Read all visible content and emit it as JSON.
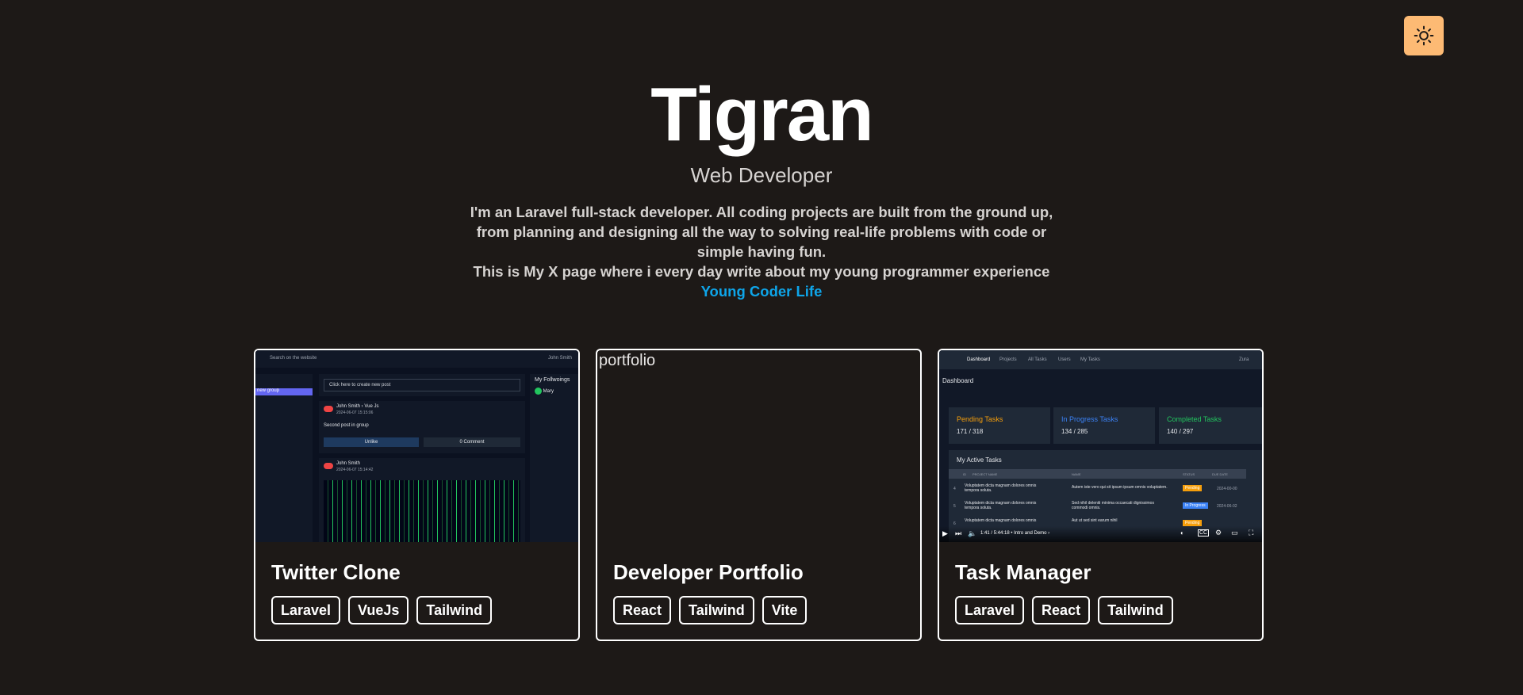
{
  "colors": {
    "background": "#1d1917",
    "accent": "#fdba74",
    "link": "#0ea5e9"
  },
  "theme_toggle": {
    "icon": "sun-icon"
  },
  "hero": {
    "name": "Tigran",
    "subtitle": "Web Developer",
    "bio_line1": "I'm an Laravel full-stack developer. All coding projects are built from the ground up, from planning and designing all the way to solving real-life problems with code or simple having fun.",
    "bio_line2": "This is My X page where i every day write about my young programmer experience",
    "x_link": "Young Coder Life"
  },
  "projects": [
    {
      "title": "Twitter Clone",
      "tags": [
        "Laravel",
        "VueJs",
        "Tailwind"
      ],
      "thumb": {
        "search": "Search on the website",
        "user": "John Smith",
        "group": "new group",
        "create_post": "Click here to create new post",
        "post1_author": "John Smith › Vue Js",
        "post1_date": "2024-06-07 15:15:06",
        "post1_body": "Second post in group",
        "unlike": "Unlike",
        "comment_count": "0",
        "comment": "Comment",
        "post2_author": "John Smith",
        "post2_date": "2024-06-07 15:14:42",
        "followings_title": "My Follwoings",
        "following1": "Mary"
      }
    },
    {
      "title": "Developer Portfolio",
      "tags": [
        "React",
        "Tailwind",
        "Vite"
      ],
      "thumb": {
        "alt": "portfolio"
      }
    },
    {
      "title": "Task Manager",
      "tags": [
        "Laravel",
        "React",
        "Tailwind"
      ],
      "thumb": {
        "nav": [
          "Dashboard",
          "Projects",
          "All Tasks",
          "Users",
          "My Tasks"
        ],
        "user": "Zura",
        "heading": "Dashboard",
        "stats": [
          {
            "label": "Pending Tasks",
            "value": "171 / 318",
            "color": "#f59e0b"
          },
          {
            "label": "In Progress Tasks",
            "value": "134 / 285",
            "color": "#3b82f6"
          },
          {
            "label": "Completed Tasks",
            "value": "140 / 297",
            "color": "#22c55e"
          }
        ],
        "active_title": "My Active Tasks",
        "columns": [
          "ID",
          "PROJECT NAME",
          "NAME",
          "STATUS",
          "DUE DATE"
        ],
        "rows": [
          {
            "id": "4",
            "project": "Voluptatem dicta magnam dolores omnis tempora soluta.",
            "name": "Autem iste vero qui sit ipsum ipsum omnis voluptatem.",
            "status": "Pending",
            "status_color": "#f59e0b",
            "due": "2024-00-00"
          },
          {
            "id": "5",
            "project": "Voluptatem dicta magnam dolores omnis tempora soluta.",
            "name": "Sed nihil deleniti minima occaecati dignissimos commodi omnis.",
            "status": "In Progress",
            "status_color": "#3b82f6",
            "due": "2024-06-02"
          },
          {
            "id": "6",
            "project": "Voluptatem dicta magnam dolores omnis",
            "name": "Aut ut sed sint earum nihil",
            "status": "Pending",
            "status_color": "#f59e0b",
            "due": ""
          }
        ],
        "video_time": "1:41 / 5:44:18 • Intro and Demo ›"
      }
    }
  ]
}
